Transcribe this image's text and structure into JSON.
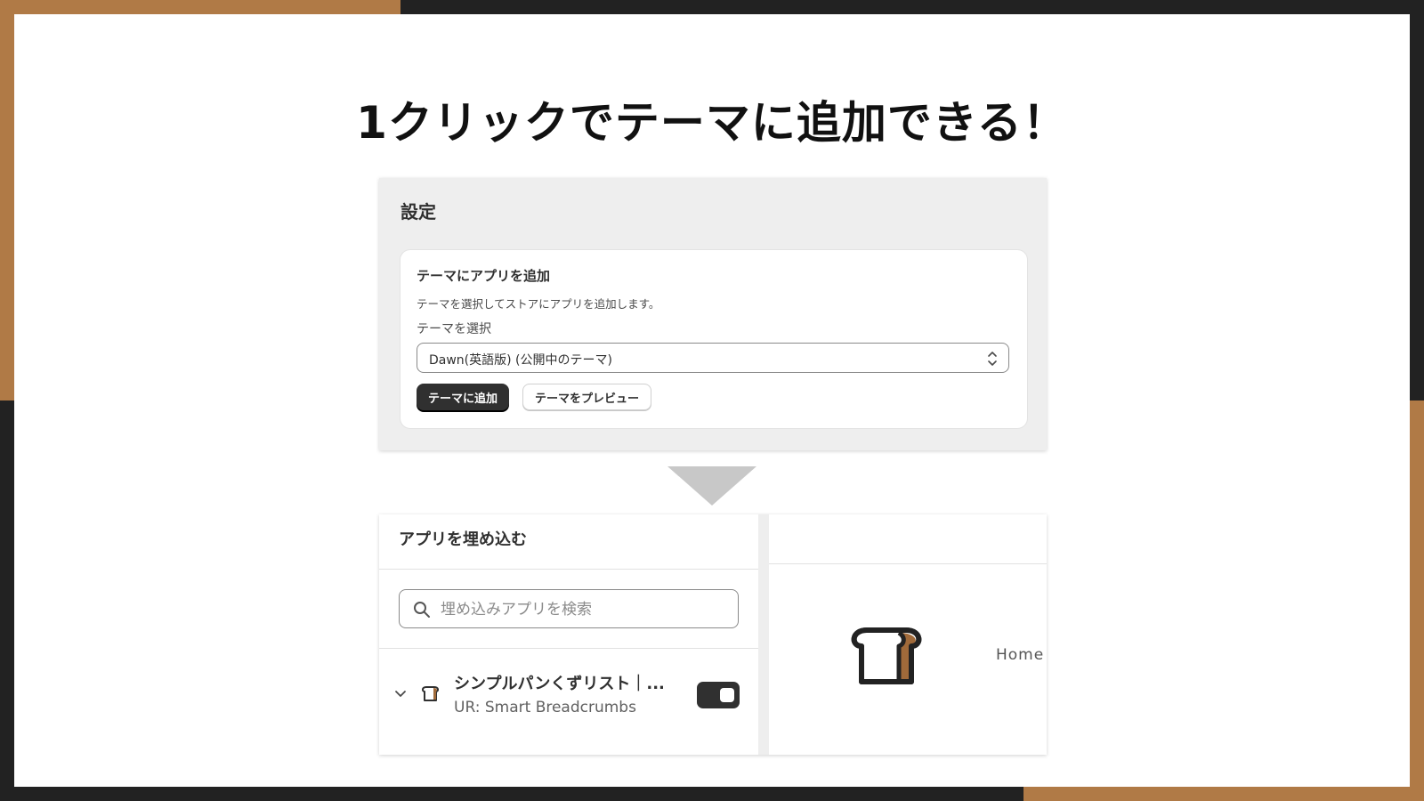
{
  "slide": {
    "headline": "1クリックでテーマに追加できる！"
  },
  "settings": {
    "title": "設定",
    "card": {
      "title": "テーマにアプリを追加",
      "description": "テーマを選択してストアにアプリを追加します。",
      "field_label": "テーマを選択",
      "selected_theme": "Dawn(英語版) (公開中のテーマ)",
      "add_button": "テーマに追加",
      "preview_button": "テーマをプレビュー"
    }
  },
  "embed": {
    "title": "アプリを埋め込む",
    "search_placeholder": "埋め込みアプリを検索",
    "app": {
      "name": "シンプルパンくずリスト｜...",
      "subtitle": "UR: Smart Breadcrumbs",
      "enabled": true
    }
  },
  "preview": {
    "home_link": "Home"
  },
  "colors": {
    "accent": "#b07a46",
    "frame": "#222222",
    "primary_button": "#303030"
  },
  "icons": [
    "search-icon",
    "chevron-down-icon",
    "select-chevrons-icon",
    "bread-icon",
    "down-arrow-icon"
  ]
}
